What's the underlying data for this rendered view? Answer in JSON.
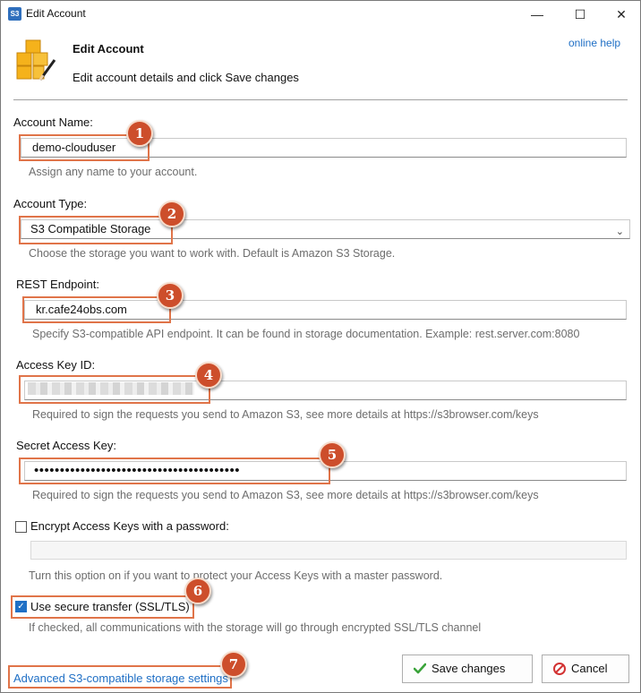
{
  "window": {
    "title": "Edit Account",
    "app_icon": "S3",
    "controls": {
      "minimize": "—",
      "maximize": "☐",
      "close": "✕"
    }
  },
  "header": {
    "title": "Edit Account",
    "subtitle": "Edit account details and click Save changes",
    "help_link": "online help",
    "icon": "boxes-pencil-icon"
  },
  "fields": {
    "account_name": {
      "label": "Account Name:",
      "value": "demo-clouduser",
      "hint": "Assign any name to your account."
    },
    "account_type": {
      "label": "Account Type:",
      "value": "S3 Compatible Storage",
      "hint": "Choose the storage you want to work with. Default is Amazon S3 Storage."
    },
    "rest_endpoint": {
      "label": "REST Endpoint:",
      "value": "kr.cafe24obs.com",
      "hint": "Specify S3-compatible API endpoint. It can be found in storage documentation. Example: rest.server.com:8080"
    },
    "access_key_id": {
      "label": "Access Key ID:",
      "value": "",
      "hint": "Required to sign the requests you send to Amazon S3, see more details at https://s3browser.com/keys"
    },
    "secret_access_key": {
      "label": "Secret Access Key:",
      "value": "••••••••••••••••••••••••••••••••••••••••",
      "hint": "Required to sign the requests you send to Amazon S3, see more details at https://s3browser.com/keys"
    }
  },
  "options": {
    "encrypt": {
      "label": "Encrypt Access Keys with a password:",
      "checked": false,
      "hint": "Turn this option on if you want to protect your Access Keys with a master password."
    },
    "secure_transfer": {
      "label": "Use secure transfer (SSL/TLS)",
      "checked": true,
      "hint": "If checked, all communications with the storage will go through encrypted SSL/TLS channel"
    }
  },
  "footer": {
    "advanced_link": "Advanced S3-compatible storage settings",
    "save_label": "Save changes",
    "cancel_label": "Cancel"
  },
  "callouts": [
    "1",
    "2",
    "3",
    "4",
    "5",
    "6",
    "7"
  ],
  "colors": {
    "callout_border": "#e07449",
    "badge_fill": "#cd4e2b",
    "link": "#1f6fc5"
  }
}
